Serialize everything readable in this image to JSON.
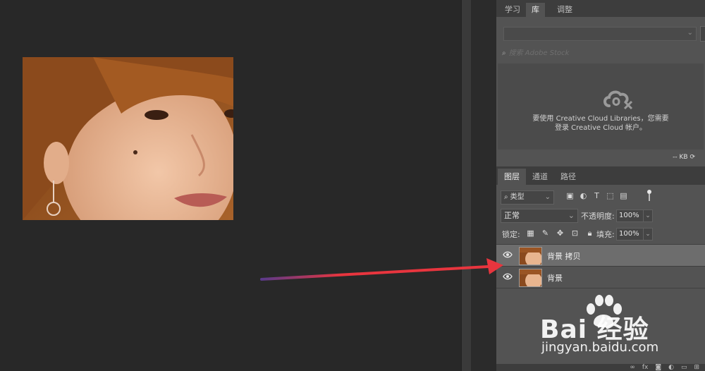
{
  "library_panel": {
    "tabs": [
      {
        "label": "学习",
        "active": false
      },
      {
        "label": "库",
        "active": true
      },
      {
        "label": "调整",
        "active": false
      }
    ],
    "library_dropdown_value": "",
    "search_placeholder": "搜索 Adobe Stock",
    "message_line1": "要使用 Creative Cloud Libraries，您需要",
    "message_line2": "登录 Creative Cloud 帐户。",
    "storage_label": "-- KB"
  },
  "layers_panel": {
    "tabs": [
      {
        "label": "图层",
        "active": true
      },
      {
        "label": "通道",
        "active": false
      },
      {
        "label": "路径",
        "active": false
      }
    ],
    "filter_label": "类型",
    "blend_mode": "正常",
    "opacity_label": "不透明度:",
    "opacity_value": "100%",
    "lock_label": "锁定:",
    "fill_label": "填充:",
    "fill_value": "100%",
    "layers": [
      {
        "name": "背景 拷贝",
        "selected": true,
        "visible": true
      },
      {
        "name": "背景",
        "selected": false,
        "visible": true
      }
    ]
  },
  "annotation": {
    "arrow_color": "#e8353e"
  },
  "watermark": {
    "brand": "Bai 经验",
    "url": "jingyan.baidu.com"
  }
}
